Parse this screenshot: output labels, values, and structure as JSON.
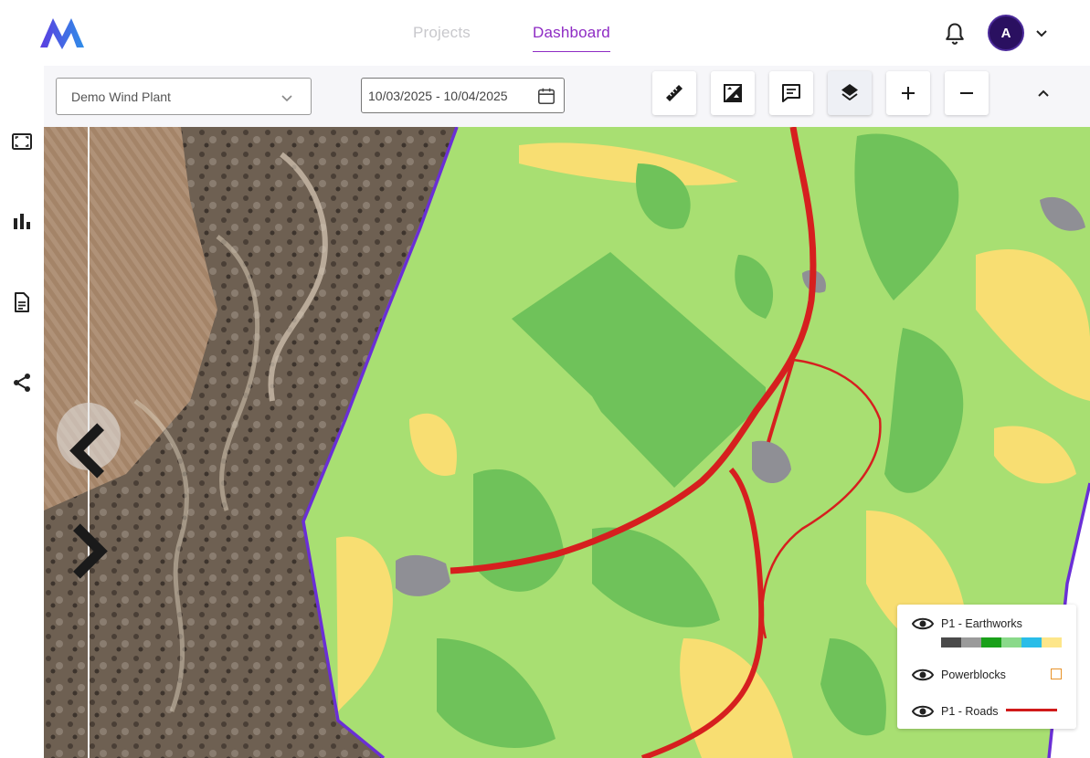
{
  "nav": {
    "tabs": [
      {
        "label": "Projects",
        "active": false
      },
      {
        "label": "Dashboard",
        "active": true
      }
    ],
    "avatar_initial": "A",
    "accent_color": "#8e2bc4"
  },
  "left_rail": {
    "icons": [
      "area-frame-icon",
      "bar-chart-icon",
      "document-icon",
      "share-icon"
    ]
  },
  "toolbar": {
    "plant_select": {
      "value": "Demo Wind Plant"
    },
    "date_range": {
      "value": "10/03/2025 - 10/04/2025"
    },
    "tools": [
      "ruler-icon",
      "compare-image-icon",
      "comment-icon",
      "layers-icon",
      "zoom-in-icon",
      "zoom-out-icon"
    ],
    "active_tool": "layers-icon"
  },
  "legend": {
    "items": [
      {
        "label": "P1 - Earthworks",
        "visible": true,
        "swatches": [
          "#4a4a4a",
          "#9a9a9a",
          "#1aa01a",
          "#8ad98a",
          "#29bde8",
          "#fde68a"
        ]
      },
      {
        "label": "Powerblocks",
        "visible": true,
        "swatch": "#e8932a"
      },
      {
        "label": "P1 - Roads",
        "visible": true,
        "swatch": "#d01a1a"
      }
    ]
  },
  "map_colors": {
    "boundary": "#6a2fd6",
    "light_vegetation": "#a8df72",
    "dense_vegetation": "#6fc25a",
    "bare_soil": "#f8de72",
    "road": "#d61f1f",
    "gravel": "#8f8f95"
  }
}
